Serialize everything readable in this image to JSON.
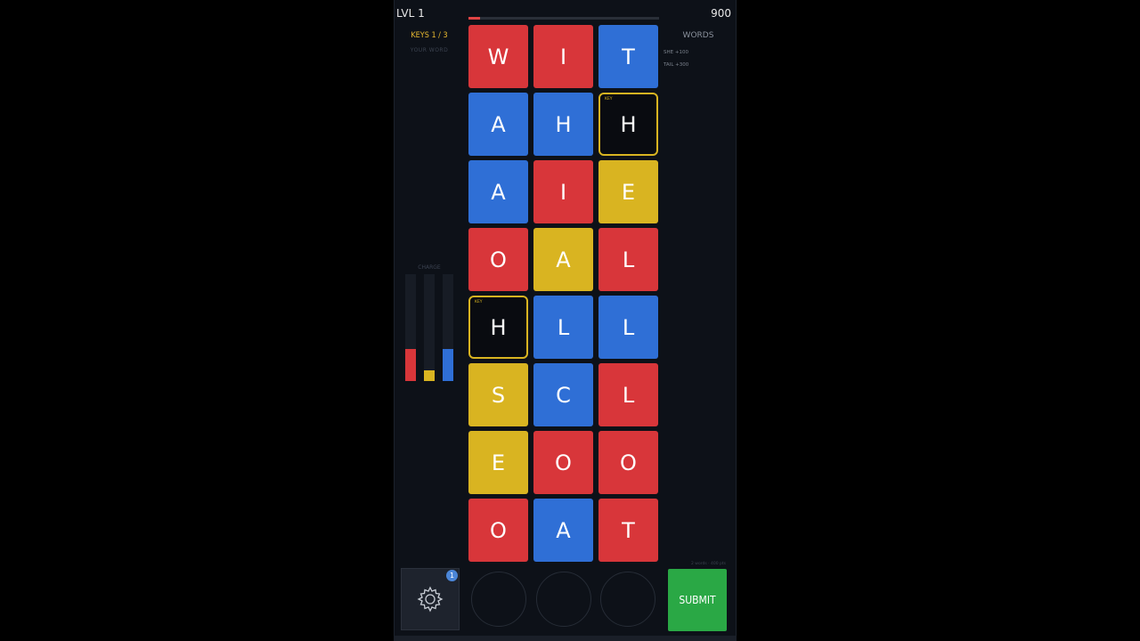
{
  "header": {
    "level": "LVL 1",
    "score": "900",
    "progress": 0.06
  },
  "left_panel": {
    "keys": "KEYS 1 / 3",
    "your_word": "YOUR WORD",
    "charge_label": "CHARGE",
    "charge_levels": [
      {
        "color": "#d8363a",
        "level": 0.3
      },
      {
        "color": "#d9b421",
        "level": 0.1
      },
      {
        "color": "#2f6fd6",
        "level": 0.3
      }
    ]
  },
  "right_panel": {
    "title": "WORDS",
    "words": [
      "SHE +100",
      "TAIL +300"
    ]
  },
  "grid": {
    "rows": [
      [
        {
          "letter": "W",
          "color": "red"
        },
        {
          "letter": "I",
          "color": "red"
        },
        {
          "letter": "T",
          "color": "blue"
        }
      ],
      [
        {
          "letter": "A",
          "color": "blue"
        },
        {
          "letter": "H",
          "color": "blue"
        },
        {
          "letter": "H",
          "color": "key",
          "tag": "KEY"
        }
      ],
      [
        {
          "letter": "A",
          "color": "blue"
        },
        {
          "letter": "I",
          "color": "red"
        },
        {
          "letter": "E",
          "color": "yellow"
        }
      ],
      [
        {
          "letter": "O",
          "color": "red"
        },
        {
          "letter": "A",
          "color": "yellow"
        },
        {
          "letter": "L",
          "color": "red"
        }
      ],
      [
        {
          "letter": "H",
          "color": "key",
          "tag": "KEY"
        },
        {
          "letter": "L",
          "color": "blue"
        },
        {
          "letter": "L",
          "color": "blue"
        }
      ],
      [
        {
          "letter": "S",
          "color": "yellow"
        },
        {
          "letter": "C",
          "color": "blue"
        },
        {
          "letter": "L",
          "color": "red"
        }
      ],
      [
        {
          "letter": "E",
          "color": "yellow"
        },
        {
          "letter": "O",
          "color": "red"
        },
        {
          "letter": "O",
          "color": "red"
        }
      ],
      [
        {
          "letter": "O",
          "color": "red"
        },
        {
          "letter": "A",
          "color": "blue"
        },
        {
          "letter": "T",
          "color": "red"
        }
      ]
    ]
  },
  "footer": {
    "info": "2 words · 400 pts",
    "badge": "1",
    "submit": "SUBMIT",
    "settings_icon": "gear-icon"
  }
}
